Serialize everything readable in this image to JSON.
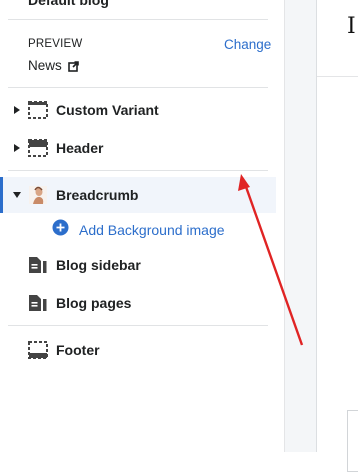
{
  "sidebar": {
    "blog_title": "Default blog",
    "preview": {
      "label": "PREVIEW",
      "value": "News",
      "change_label": "Change"
    },
    "sections": [
      {
        "label": "Custom Variant",
        "icon": "section-dashed-icon"
      },
      {
        "label": "Header",
        "icon": "header-icon"
      },
      {
        "label": "Breadcrumb",
        "icon": "image-thumbnail-icon",
        "selected": true
      },
      {
        "label": "Blog sidebar",
        "icon": "document-icon"
      },
      {
        "label": "Blog pages",
        "icon": "document-icon"
      },
      {
        "label": "Footer",
        "icon": "footer-icon"
      }
    ],
    "add_block_label": "Add Background image"
  },
  "preview_pane": {
    "partial_text": "I"
  },
  "colors": {
    "accent": "#2c6ecb",
    "annotation_arrow": "#e02424",
    "selected_row_bg": "#f1f5fb"
  }
}
